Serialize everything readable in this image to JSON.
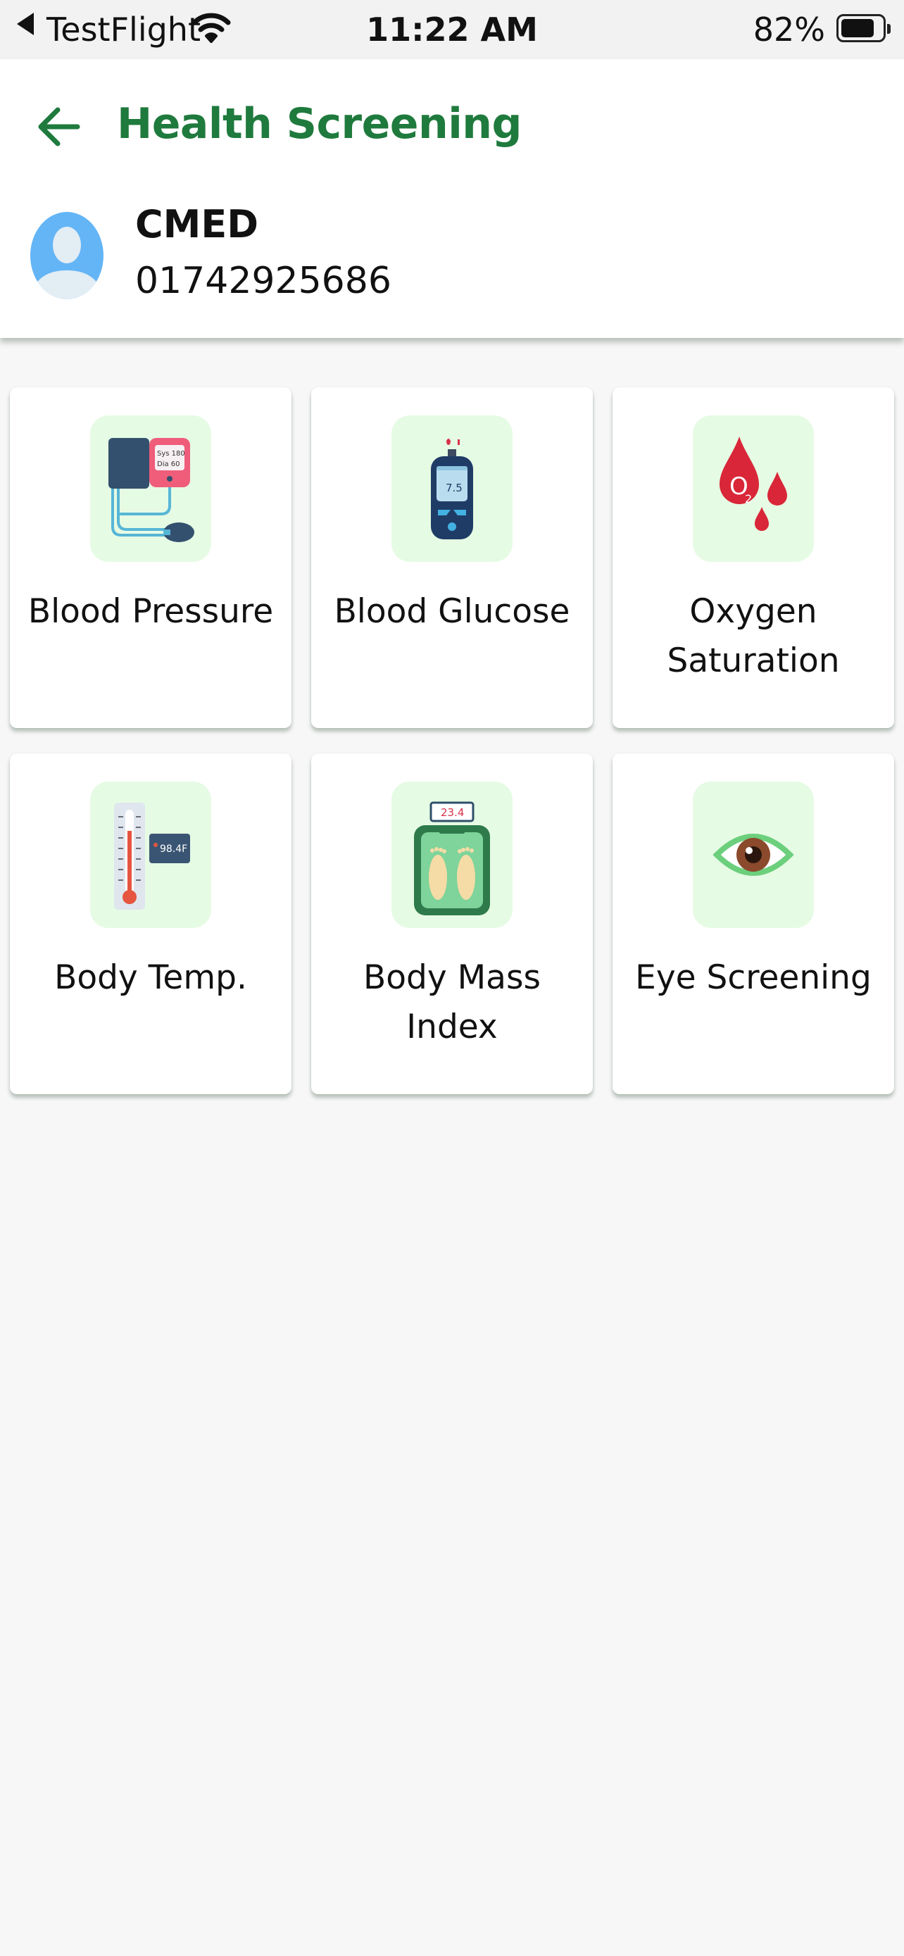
{
  "status_bar": {
    "back_app": "TestFlight",
    "time": "11:22 AM",
    "battery_percent": "82%",
    "battery_level": 0.82
  },
  "header": {
    "title": "Health Screening",
    "back_icon": "arrow-left-icon",
    "user": {
      "name": "CMED",
      "phone": "01742925686",
      "avatar_icon": "user-avatar-icon"
    }
  },
  "screenings": [
    {
      "label": "Blood Pressure",
      "icon": "blood-pressure-monitor-icon",
      "bp_sys": "Sys 180",
      "bp_dia": "Dia 60"
    },
    {
      "label": "Blood Glucose",
      "icon": "glucometer-icon",
      "reading": "7.5"
    },
    {
      "label": "Oxygen Saturation",
      "icon": "oxygen-drops-icon",
      "o": "O",
      "sub": "2"
    },
    {
      "label": "Body Temp.",
      "icon": "thermometer-icon",
      "reading": "98.4F"
    },
    {
      "label": "Body Mass Index",
      "icon": "weighing-scale-icon",
      "reading": "23.4"
    },
    {
      "label": "Eye Screening",
      "icon": "eye-icon"
    }
  ],
  "colors": {
    "accent": "#1f7a3d",
    "icon_tile_bg": "#e6fbe4",
    "page_bg": "#f7f7f7"
  }
}
